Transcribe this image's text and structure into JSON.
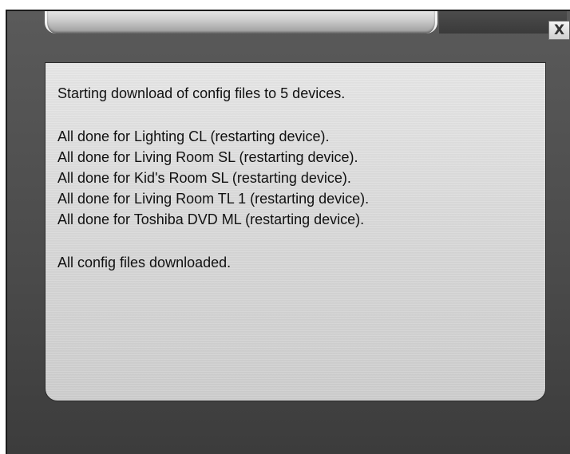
{
  "window": {
    "close_label": "X"
  },
  "log": {
    "start_line": "Starting download of config files to 5 devices.",
    "device_lines": [
      "All done for Lighting CL (restarting device).",
      "All done for Living Room SL (restarting device).",
      "All done for Kid's Room SL (restarting device).",
      "All done for Living Room TL 1 (restarting device).",
      "All done for Toshiba DVD ML (restarting device)."
    ],
    "end_line": "All config files downloaded."
  }
}
